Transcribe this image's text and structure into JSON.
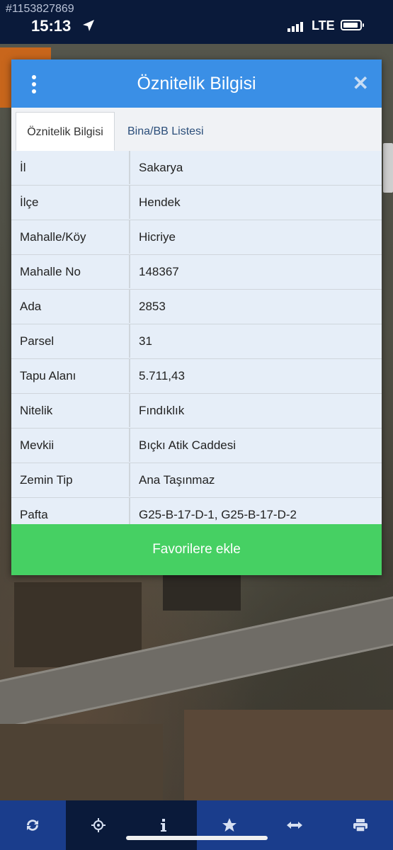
{
  "status_bar": {
    "id_text": "#1153827869",
    "time": "15:13",
    "network": "LTE"
  },
  "dialog": {
    "title": "Öznitelik Bilgisi",
    "tabs": [
      {
        "label": "Öznitelik Bilgisi",
        "active": true
      },
      {
        "label": "Bina/BB Listesi",
        "active": false
      }
    ],
    "rows": [
      {
        "key": "İl",
        "value": "Sakarya"
      },
      {
        "key": "İlçe",
        "value": "Hendek"
      },
      {
        "key": "Mahalle/Köy",
        "value": "Hicriye"
      },
      {
        "key": "Mahalle No",
        "value": "148367"
      },
      {
        "key": "Ada",
        "value": "2853"
      },
      {
        "key": "Parsel",
        "value": "31"
      },
      {
        "key": "Tapu Alanı",
        "value": "5.711,43"
      },
      {
        "key": "Nitelik",
        "value": "Fındıklık"
      },
      {
        "key": "Mevkii",
        "value": "Bıçkı Atik Caddesi"
      },
      {
        "key": "Zemin Tip",
        "value": "Ana Taşınmaz"
      },
      {
        "key": "Pafta",
        "value": "G25-B-17-D-1, G25-B-17-D-2"
      }
    ],
    "favorite_button": "Favorilere ekle"
  },
  "toolbar": {
    "items": [
      "refresh-icon",
      "locate-icon",
      "info-icon",
      "star-icon",
      "measure-icon",
      "print-icon"
    ]
  },
  "colors": {
    "header_blue": "#3a8fe6",
    "favorite_green": "#46d063",
    "toolbar_blue": "#1a3d8c"
  }
}
